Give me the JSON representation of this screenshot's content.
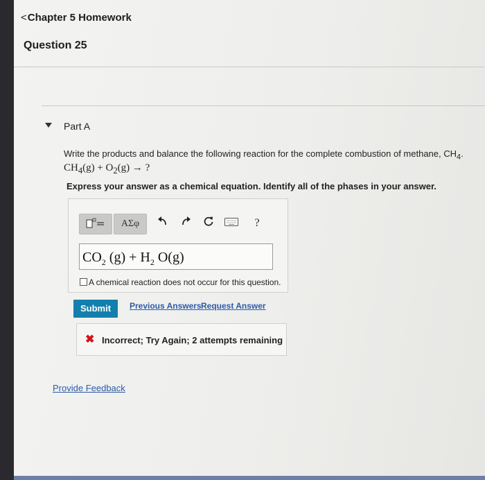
{
  "header": {
    "back_chevron": "<",
    "back_label": "Chapter 5 Homework",
    "question_title": "Question 25"
  },
  "part": {
    "title": "Part A",
    "prompt_text": "Write the products and balance the following reaction for the complete combustion of methane, CH4.",
    "prompt_equation": "CH4(g) + O2(g) → ?",
    "instruction": "Express your answer as a chemical equation. Identify all of the phases in your answer."
  },
  "toolbar": {
    "templates_icon": "templates-icon",
    "greek_label": "ΑΣφ",
    "undo_icon": "undo-icon",
    "redo_icon": "redo-icon",
    "reset_icon": "reset-icon",
    "keyboard_icon": "keyboard-icon",
    "help_label": "?"
  },
  "answer": {
    "equation_value": "CO2 (g) + H2 O(g)",
    "no_reaction_label": "A chemical reaction does not occur for this question.",
    "no_reaction_checked": false
  },
  "actions": {
    "submit_label": "Submit",
    "previous_answers_label": "Previous Answers",
    "request_answer_label": "Request Answer"
  },
  "feedback": {
    "icon": "x-icon",
    "message": "Incorrect; Try Again; 2 attempts remaining",
    "color": "#d3121b"
  },
  "footer": {
    "provide_feedback_label": "Provide Feedback"
  },
  "colors": {
    "submit_bg": "#137fad",
    "link": "#2c5aa8"
  }
}
